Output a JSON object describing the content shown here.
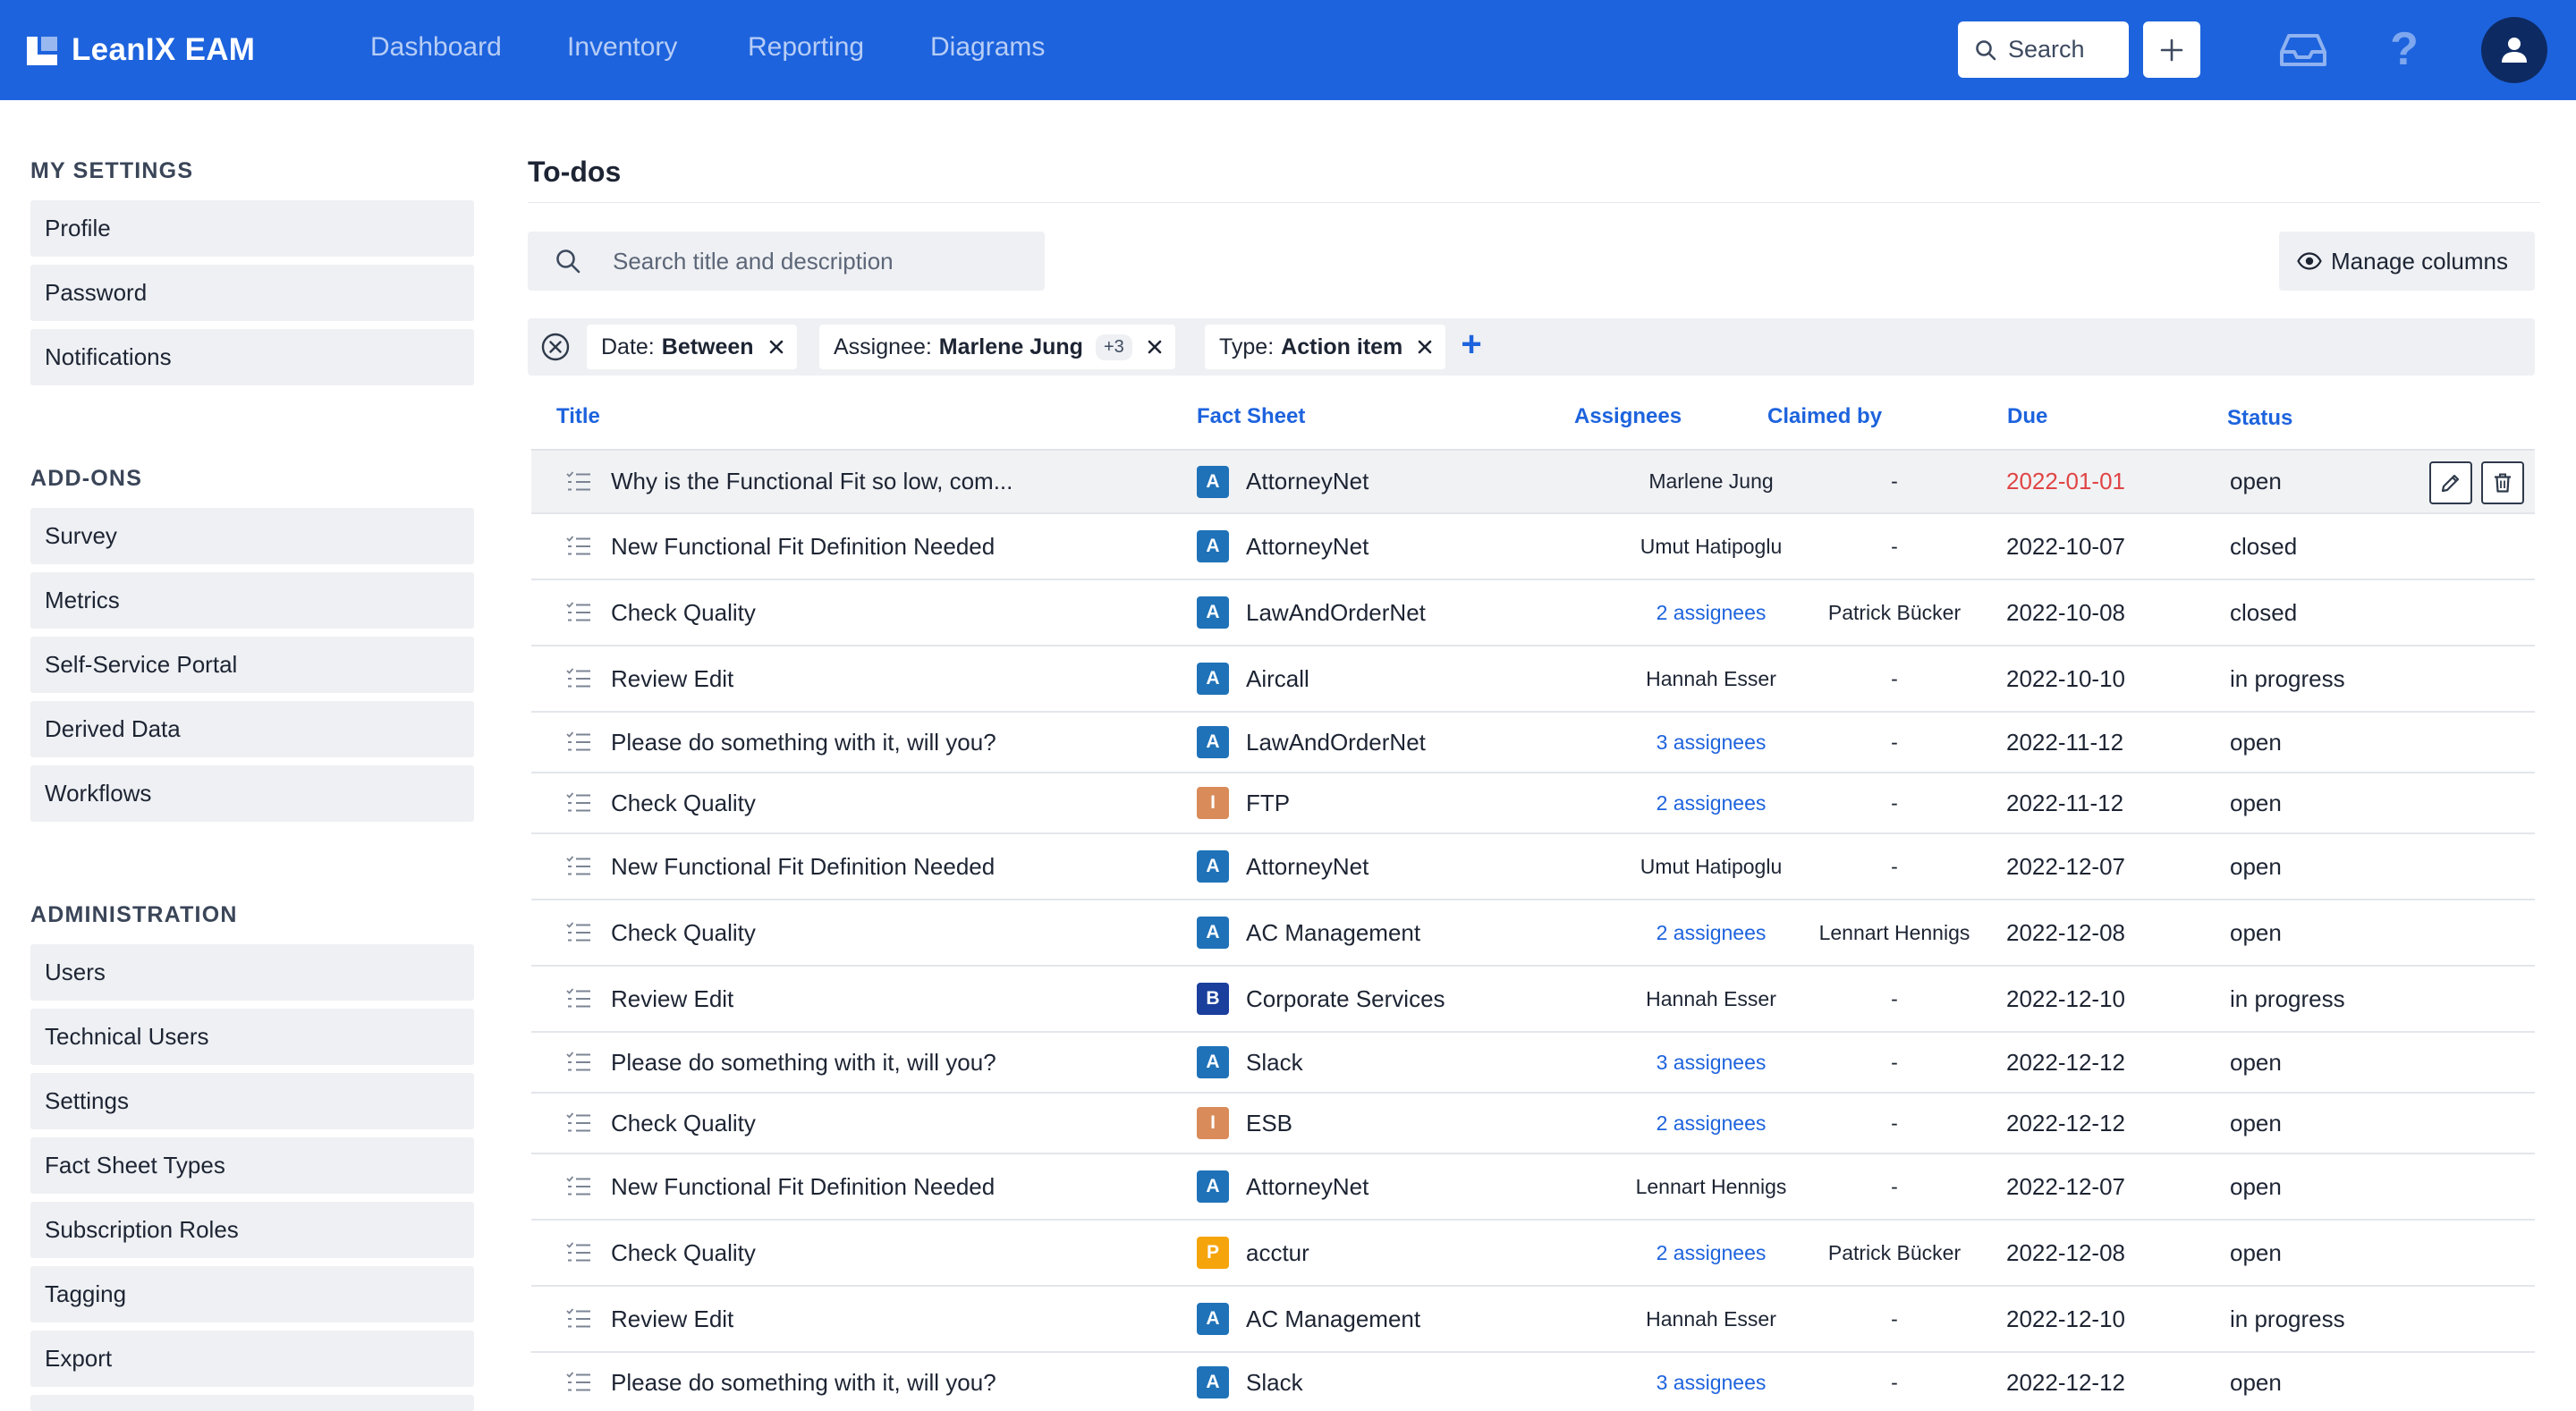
{
  "app": {
    "name": "LeanIX EAM"
  },
  "nav": {
    "items": [
      "Dashboard",
      "Inventory",
      "Reporting",
      "Diagrams"
    ]
  },
  "header": {
    "search_label": "Search"
  },
  "sidebar": {
    "sections": [
      {
        "heading": "MY SETTINGS",
        "items": [
          "Profile",
          "Password",
          "Notifications"
        ]
      },
      {
        "heading": "ADD-ONS",
        "items": [
          "Survey",
          "Metrics",
          "Self-Service Portal",
          "Derived Data",
          "Workflows"
        ]
      },
      {
        "heading": "ADMINISTRATION",
        "items": [
          "Users",
          "Technical Users",
          "Settings",
          "Fact Sheet Types",
          "Subscription Roles",
          "Tagging",
          "Export"
        ]
      }
    ]
  },
  "page": {
    "title": "To-dos",
    "search_placeholder": "Search title and description",
    "manage_columns_label": "Manage columns"
  },
  "filters": [
    {
      "key": "Date:",
      "value": "Between"
    },
    {
      "key": "Assignee:",
      "value": "Marlene Jung",
      "more": "+3"
    },
    {
      "key": "Type:",
      "value": "Action item"
    }
  ],
  "table": {
    "columns": [
      "Title",
      "Fact Sheet",
      "Assignees",
      "Claimed by",
      "Due",
      "Status"
    ],
    "rows": [
      {
        "title": "Why is the Functional Fit so low, com...",
        "fs_letter": "A",
        "fs_color": "#1f72b8",
        "fact_sheet": "AttorneyNet",
        "assignees": "Marlene Jung",
        "assignees_link": false,
        "claimed_by": "-",
        "due": "2022-01-01",
        "overdue": true,
        "status": "open"
      },
      {
        "title": "New Functional Fit Definition Needed",
        "fs_letter": "A",
        "fs_color": "#1f72b8",
        "fact_sheet": "AttorneyNet",
        "assignees": "Umut Hatipoglu",
        "assignees_link": false,
        "claimed_by": "-",
        "due": "2022-10-07",
        "overdue": false,
        "status": "closed"
      },
      {
        "title": "Check Quality",
        "fs_letter": "A",
        "fs_color": "#1f72b8",
        "fact_sheet": "LawAndOrderNet",
        "assignees": "2 assignees",
        "assignees_link": true,
        "claimed_by": "Patrick Bücker",
        "due": "2022-10-08",
        "overdue": false,
        "status": "closed"
      },
      {
        "title": "Review Edit",
        "fs_letter": "A",
        "fs_color": "#1f72b8",
        "fact_sheet": "Aircall",
        "assignees": "Hannah Esser",
        "assignees_link": false,
        "claimed_by": "-",
        "due": "2022-10-10",
        "overdue": false,
        "status": "in progress"
      },
      {
        "title": "Please do something with it, will you?",
        "fs_letter": "A",
        "fs_color": "#1f72b8",
        "fact_sheet": "LawAndOrderNet",
        "assignees": "3 assignees",
        "assignees_link": true,
        "claimed_by": "-",
        "due": "2022-11-12",
        "overdue": false,
        "status": "open"
      },
      {
        "title": "Check Quality",
        "fs_letter": "I",
        "fs_color": "#d98b5a",
        "fact_sheet": "FTP",
        "assignees": "2 assignees",
        "assignees_link": true,
        "claimed_by": "-",
        "due": "2022-11-12",
        "overdue": false,
        "status": "open"
      },
      {
        "title": "New Functional Fit Definition Needed",
        "fs_letter": "A",
        "fs_color": "#1f72b8",
        "fact_sheet": "AttorneyNet",
        "assignees": "Umut Hatipoglu",
        "assignees_link": false,
        "claimed_by": "-",
        "due": "2022-12-07",
        "overdue": false,
        "status": "open"
      },
      {
        "title": "Check Quality",
        "fs_letter": "A",
        "fs_color": "#1f72b8",
        "fact_sheet": "AC Management",
        "assignees": "2 assignees",
        "assignees_link": true,
        "claimed_by": "Lennart Hennigs",
        "due": "2022-12-08",
        "overdue": false,
        "status": "open"
      },
      {
        "title": "Review Edit",
        "fs_letter": "B",
        "fs_color": "#1a3f9c",
        "fact_sheet": "Corporate Services",
        "assignees": "Hannah Esser",
        "assignees_link": false,
        "claimed_by": "-",
        "due": "2022-12-10",
        "overdue": false,
        "status": "in progress"
      },
      {
        "title": "Please do something with it, will you?",
        "fs_letter": "A",
        "fs_color": "#1f72b8",
        "fact_sheet": "Slack",
        "assignees": "3 assignees",
        "assignees_link": true,
        "claimed_by": "-",
        "due": "2022-12-12",
        "overdue": false,
        "status": "open"
      },
      {
        "title": "Check Quality",
        "fs_letter": "I",
        "fs_color": "#d98b5a",
        "fact_sheet": "ESB",
        "assignees": "2 assignees",
        "assignees_link": true,
        "claimed_by": "-",
        "due": "2022-12-12",
        "overdue": false,
        "status": "open"
      },
      {
        "title": "New Functional Fit Definition Needed",
        "fs_letter": "A",
        "fs_color": "#1f72b8",
        "fact_sheet": "AttorneyNet",
        "assignees": "Lennart Hennigs",
        "assignees_link": false,
        "claimed_by": "-",
        "due": "2022-12-07",
        "overdue": false,
        "status": "open"
      },
      {
        "title": "Check Quality",
        "fs_letter": "P",
        "fs_color": "#f5a40c",
        "fact_sheet": "acctur",
        "assignees": "2 assignees",
        "assignees_link": true,
        "claimed_by": "Patrick Bücker",
        "due": "2022-12-08",
        "overdue": false,
        "status": "open"
      },
      {
        "title": "Review Edit",
        "fs_letter": "A",
        "fs_color": "#1f72b8",
        "fact_sheet": "AC Management",
        "assignees": "Hannah Esser",
        "assignees_link": false,
        "claimed_by": "-",
        "due": "2022-12-10",
        "overdue": false,
        "status": "in progress"
      },
      {
        "title": "Please do something with it, will you?",
        "fs_letter": "A",
        "fs_color": "#1f72b8",
        "fact_sheet": "Slack",
        "assignees": "3 assignees",
        "assignees_link": true,
        "claimed_by": "-",
        "due": "2022-12-12",
        "overdue": false,
        "status": "open"
      }
    ]
  },
  "colors": {
    "brand": "#1d63dd",
    "overdue": "#e04545"
  }
}
